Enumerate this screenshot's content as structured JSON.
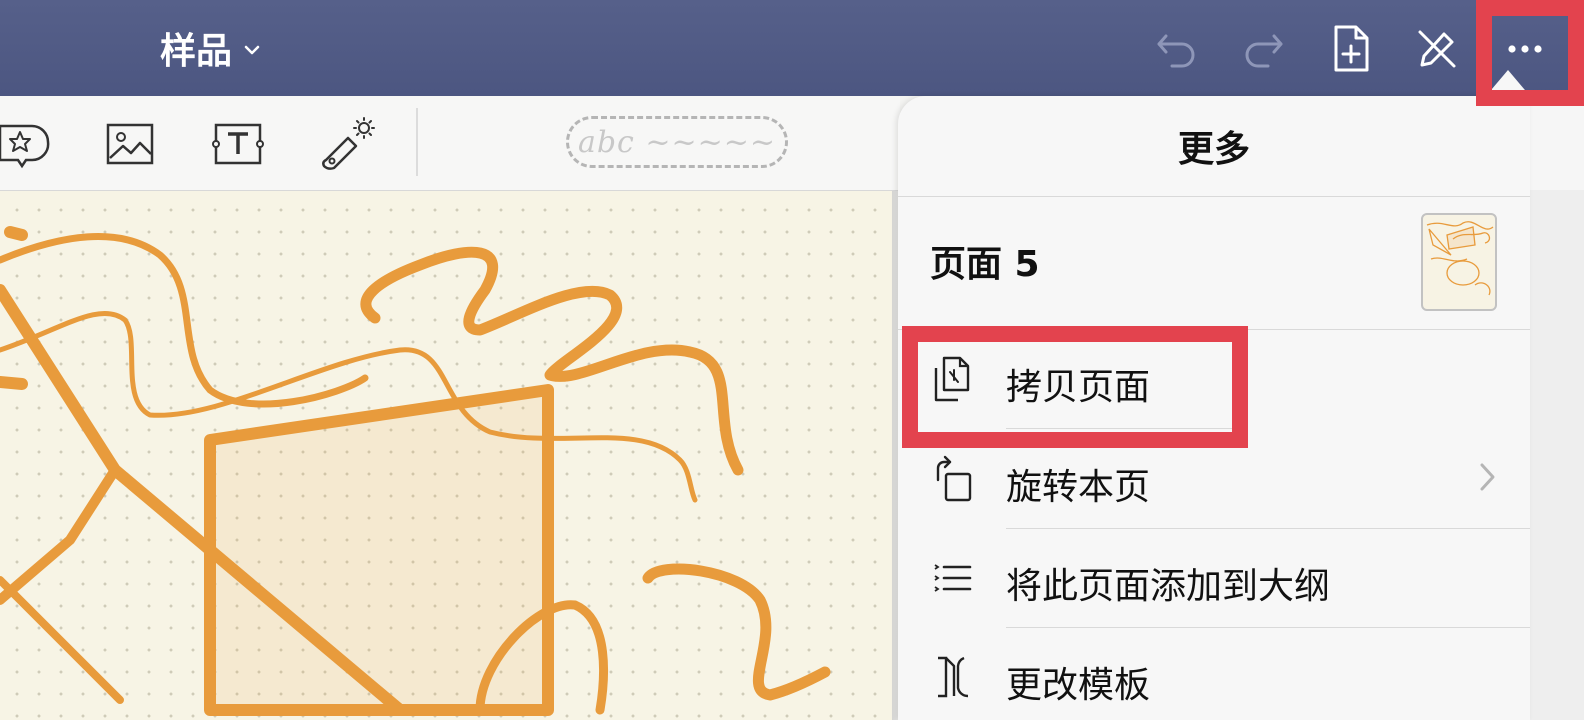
{
  "header": {
    "doc_title": "样品",
    "icons": [
      "undo-icon",
      "redo-icon",
      "add-page-icon",
      "pen-off-icon",
      "more-icon"
    ]
  },
  "toolbar": {
    "pen_preview": "abc ~~~~~",
    "icons": [
      "sticker-icon",
      "image-icon",
      "text-box-icon",
      "laser-pointer-icon"
    ]
  },
  "more_panel": {
    "title": "更多",
    "page_label": "页面 5",
    "items": [
      {
        "label": "拷贝页面",
        "icon": "copy-page-icon",
        "has_chevron": false
      },
      {
        "label": "旋转本页",
        "icon": "rotate-page-icon",
        "has_chevron": true
      },
      {
        "label": "将此页面添加到大纲",
        "icon": "outline-list-icon",
        "has_chevron": false
      },
      {
        "label": "更改模板",
        "icon": "change-template-icon",
        "has_chevron": false
      }
    ]
  },
  "colors": {
    "header_bg": "#515b85",
    "highlight": "#e3434e",
    "ink": "#e89b3c",
    "paper": "#f7f4e5"
  }
}
